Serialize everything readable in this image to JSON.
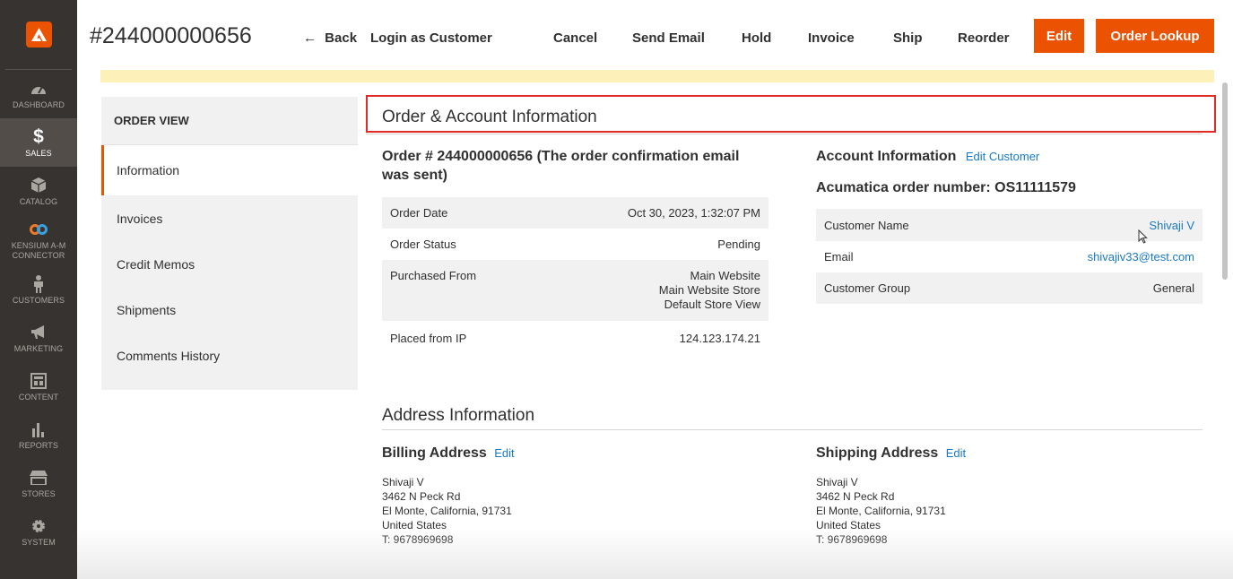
{
  "sidebar": {
    "logo": "adobe-logo",
    "items": [
      {
        "label": "DASHBOARD",
        "icon": "speedometer-icon"
      },
      {
        "label": "SALES",
        "icon": "dollar-icon"
      },
      {
        "label": "CATALOG",
        "icon": "cube-icon"
      },
      {
        "label": "KENSIUM A-M CONNECTOR",
        "icon": "connector-icon"
      },
      {
        "label": "CUSTOMERS",
        "icon": "person-icon"
      },
      {
        "label": "MARKETING",
        "icon": "megaphone-icon"
      },
      {
        "label": "CONTENT",
        "icon": "layout-icon"
      },
      {
        "label": "REPORTS",
        "icon": "bar-chart-icon"
      },
      {
        "label": "STORES",
        "icon": "store-icon"
      },
      {
        "label": "SYSTEM",
        "icon": "gear-icon"
      }
    ]
  },
  "header": {
    "order_number": "#244000000656",
    "back": "Back",
    "login_as_customer": "Login as Customer",
    "cancel": "Cancel",
    "send_email": "Send Email",
    "hold": "Hold",
    "invoice": "Invoice",
    "ship": "Ship",
    "reorder": "Reorder",
    "edit": "Edit",
    "order_lookup": "Order Lookup"
  },
  "tabs": {
    "title": "ORDER VIEW",
    "items": [
      "Information",
      "Invoices",
      "Credit Memos",
      "Shipments",
      "Comments History"
    ]
  },
  "order_account": {
    "section_title": "Order & Account Information",
    "order_heading": "Order # 244000000656 (The order confirmation email was sent)",
    "order_rows": [
      {
        "label": "Order Date",
        "value": "Oct 30, 2023, 1:32:07 PM"
      },
      {
        "label": "Order Status",
        "value": "Pending"
      },
      {
        "label": "Purchased From",
        "value_lines": [
          "Main Website",
          "Main Website Store",
          "Default Store View"
        ]
      },
      {
        "label": "Placed from IP",
        "value": "124.123.174.21"
      }
    ],
    "account_heading": "Account Information",
    "edit_customer": "Edit Customer",
    "acumatica_order": "Acumatica order number: OS11111579",
    "account_rows": [
      {
        "label": "Customer Name",
        "value": "Shivaji V"
      },
      {
        "label": "Email",
        "value": "shivajiv33@test.com"
      },
      {
        "label": "Customer Group",
        "value": "General"
      }
    ]
  },
  "address": {
    "section_title": "Address Information",
    "billing_heading": "Billing Address",
    "shipping_heading": "Shipping Address",
    "edit": "Edit",
    "billing_lines": [
      "Shivaji V",
      "3462 N Peck Rd",
      "El Monte, California, 91731",
      "United States",
      "T: 9678969698"
    ],
    "shipping_lines": [
      "Shivaji V",
      "3462 N Peck Rd",
      "El Monte, California, 91731",
      "United States",
      "T: 9678969698"
    ]
  },
  "colors": {
    "accent": "#eb5202",
    "link": "#1979c3",
    "sidebar": "#373330",
    "highlight": "#e02b27"
  }
}
